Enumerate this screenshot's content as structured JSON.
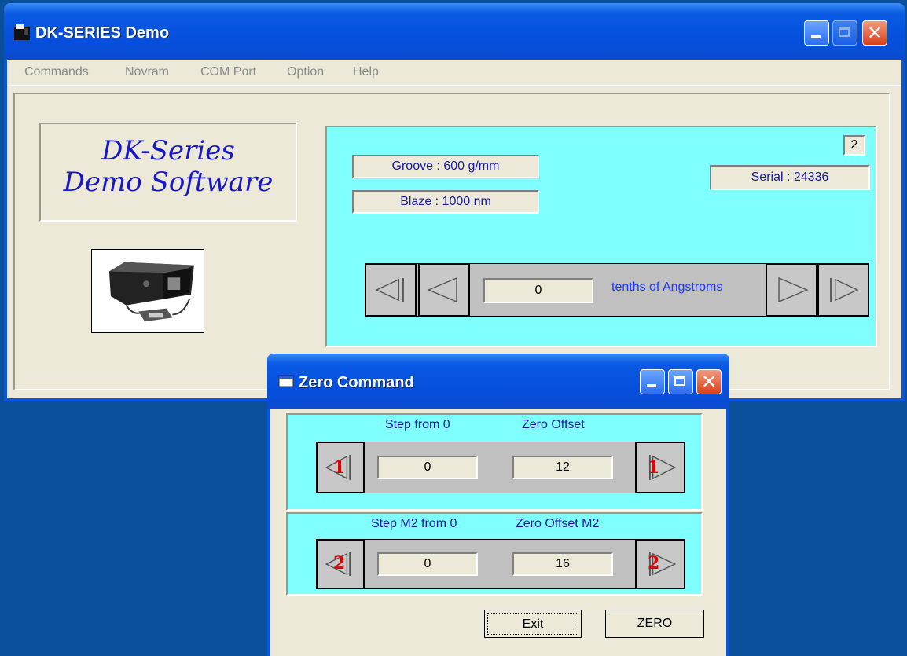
{
  "main_window": {
    "title": "DK-SERIES Demo",
    "menu": [
      "Commands",
      "Novram",
      "COM Port",
      "Option",
      "Help"
    ],
    "logo_line1": "DK-Series",
    "logo_line2": "Demo Software",
    "groove": "Groove : 600 g/mm",
    "blaze": "Blaze : 1000 nm",
    "serial": "Serial : 24336",
    "grating_number": "2",
    "position_value": "0",
    "units_label": "tenths of Angstroms"
  },
  "dialog": {
    "title": "Zero Command",
    "row1": {
      "step_label": "Step from 0",
      "offset_label": "Zero Offset",
      "step_value": "0",
      "offset_value": "12",
      "motor": "1"
    },
    "row2": {
      "step_label": "Step M2 from 0",
      "offset_label": "Zero Offset M2",
      "step_value": "0",
      "offset_value": "16",
      "motor": "2"
    },
    "exit_label": "Exit",
    "zero_label": "ZERO"
  },
  "colors": {
    "panel_cyan": "#80ffff",
    "title_blue": "#0550de",
    "accent_red": "#e00000",
    "text_blue": "#1a3aff"
  }
}
